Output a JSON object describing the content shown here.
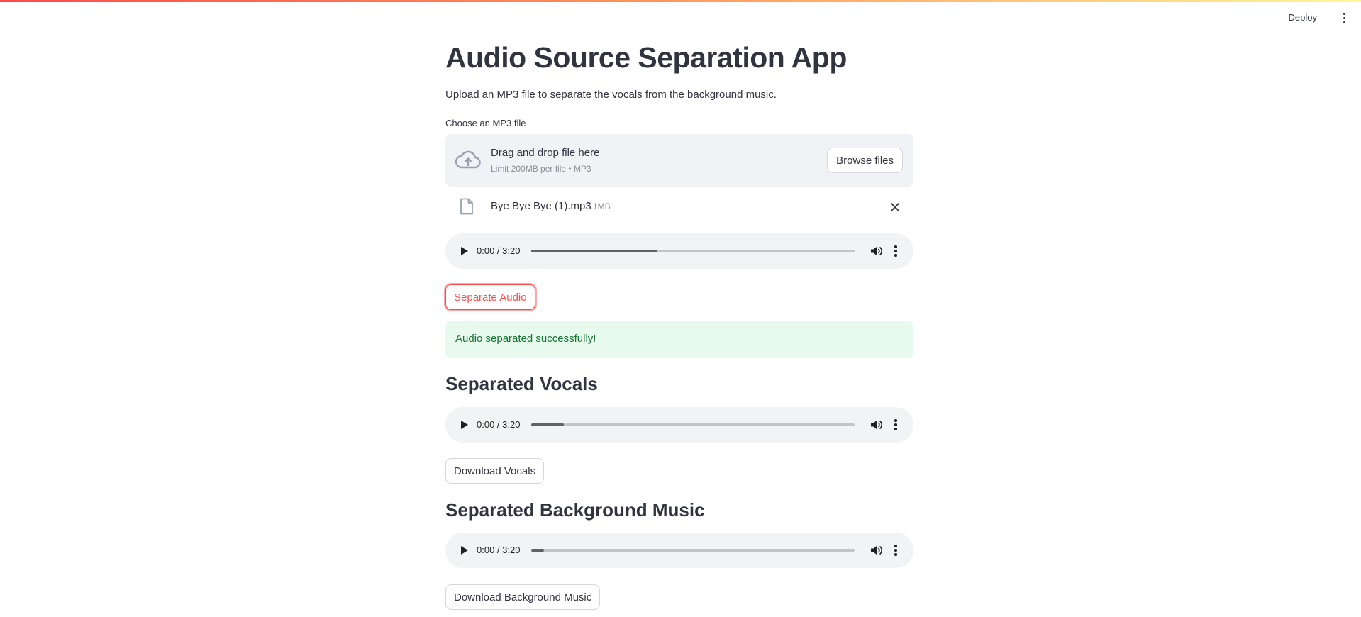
{
  "header": {
    "deploy_label": "Deploy",
    "menu_icon": "vertical-dots-icon"
  },
  "page": {
    "title": "Audio Source Separation App",
    "subtitle": "Upload an MP3 file to separate the vocals from the background music."
  },
  "uploader": {
    "label": "Choose an MP3 file",
    "drop_text": "Drag and drop file here",
    "limit_text": "Limit 200MB per file • MP3",
    "browse_label": "Browse files",
    "icon": "cloud-upload-icon",
    "file": {
      "name": "Bye Bye Bye (1).mp3",
      "size": "3.1MB",
      "icon": "file-icon"
    }
  },
  "players": {
    "original": {
      "time": "0:00 / 3:20",
      "progress": 0.39
    },
    "vocals": {
      "time": "0:00 / 3:20",
      "progress": 0.1
    },
    "background": {
      "time": "0:00 / 3:20",
      "progress": 0.04
    }
  },
  "actions": {
    "separate_label": "Separate Audio",
    "download_vocals_label": "Download Vocals",
    "download_background_label": "Download Background Music"
  },
  "status": {
    "success_message": "Audio separated successfully!"
  },
  "sections": {
    "vocals_heading": "Separated Vocals",
    "background_heading": "Separated Background Music"
  },
  "colors": {
    "accent": "#ff4b4b",
    "success_bg": "#e8f9ee",
    "success_text": "#177233",
    "dropzone_bg": "#f0f2f6"
  }
}
